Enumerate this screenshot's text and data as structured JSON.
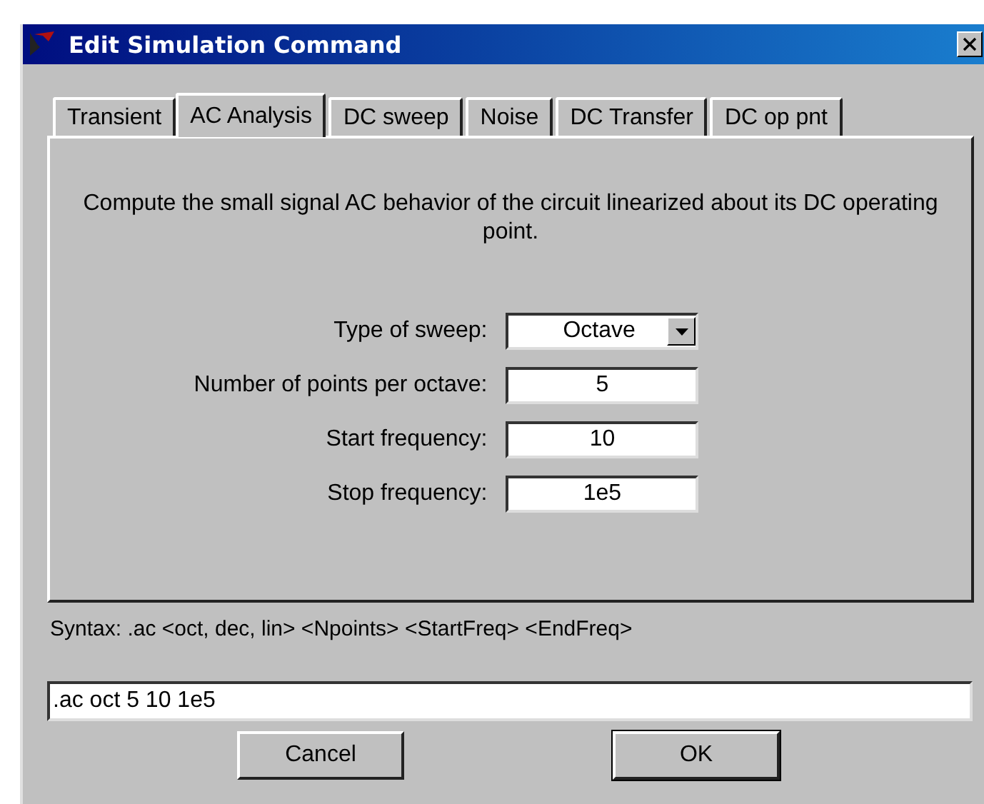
{
  "window": {
    "title": "Edit Simulation Command"
  },
  "tabs": [
    {
      "label": "Transient",
      "selected": false
    },
    {
      "label": "AC Analysis",
      "selected": true
    },
    {
      "label": "DC sweep",
      "selected": false
    },
    {
      "label": "Noise",
      "selected": false
    },
    {
      "label": "DC Transfer",
      "selected": false
    },
    {
      "label": "DC op pnt",
      "selected": false
    }
  ],
  "description": "Compute the small signal AC behavior of the circuit linearized about its DC operating point.",
  "fields": [
    {
      "label": "Type of sweep:",
      "kind": "select",
      "value": "Octave"
    },
    {
      "label": "Number of points per octave:",
      "kind": "text",
      "value": "5"
    },
    {
      "label": "Start frequency:",
      "kind": "text",
      "value": "10"
    },
    {
      "label": "Stop frequency:",
      "kind": "text",
      "value": "1e5"
    }
  ],
  "syntax": "Syntax:  .ac <oct, dec, lin> <Npoints> <StartFreq> <EndFreq>",
  "command": ".ac oct 5 10 1e5",
  "buttons": [
    {
      "label": "Cancel",
      "default": false
    },
    {
      "label": "OK",
      "default": true
    }
  ]
}
